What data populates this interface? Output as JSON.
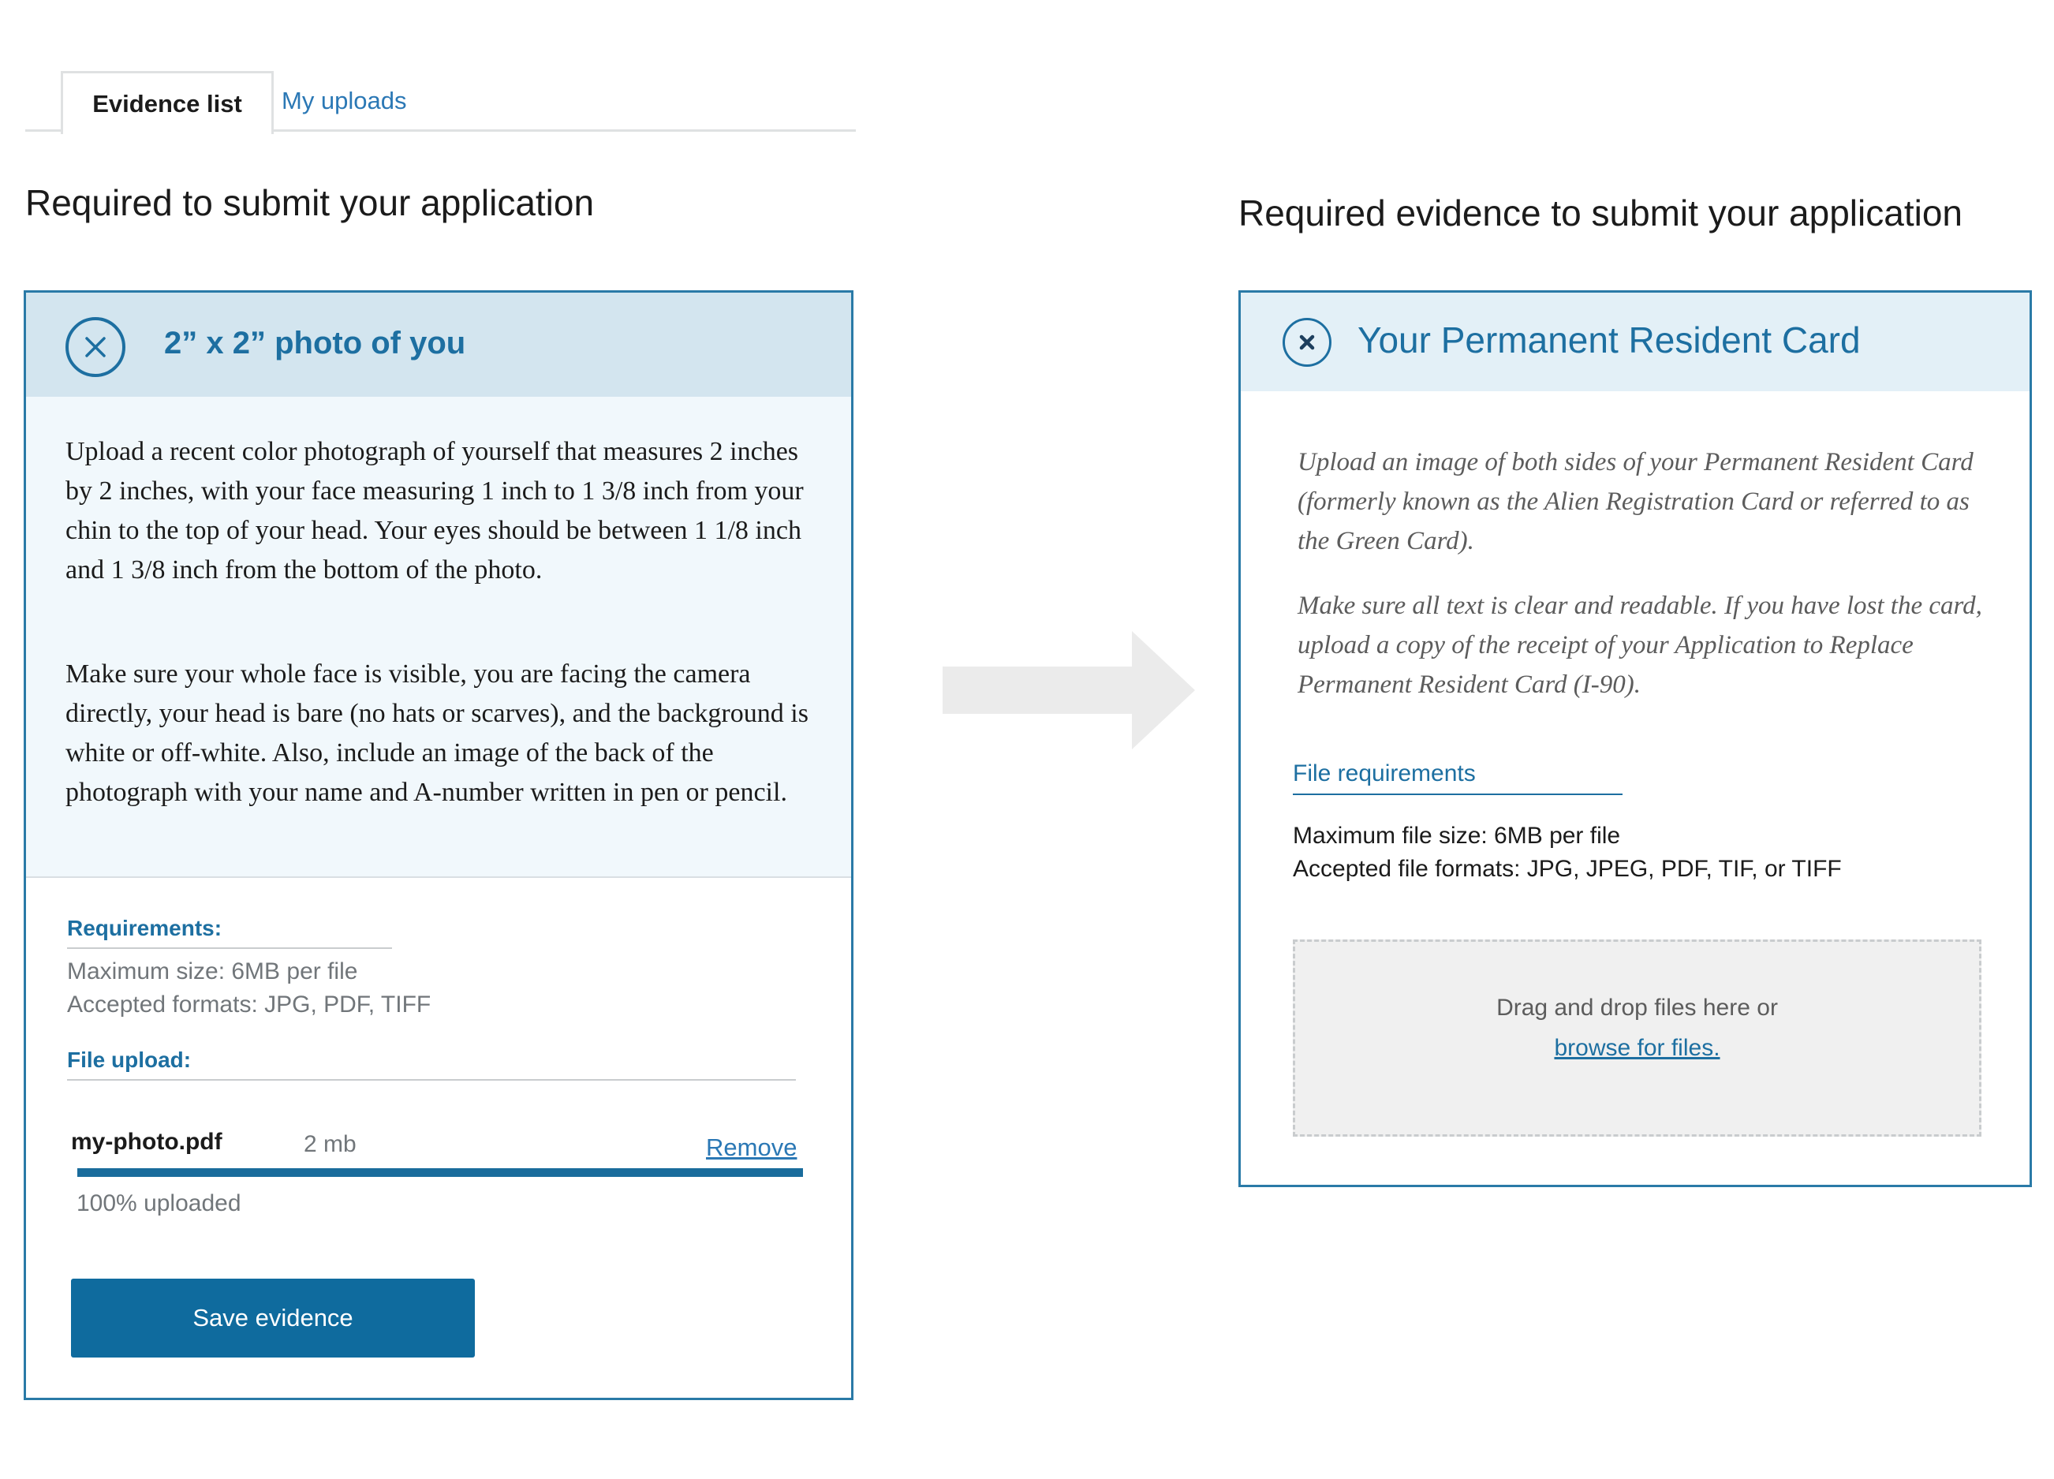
{
  "tabs": {
    "active": "Evidence list",
    "other": "My uploads"
  },
  "left": {
    "heading": "Required to submit your application",
    "card": {
      "title": "2” x 2” photo of you",
      "paragraph1": "Upload a recent color photograph of yourself that measures 2 inches by 2 inches, with your face measuring 1 inch to 1 3/8 inch from your chin to the top of your head. Your eyes should be between 1 1/8 inch and 1 3/8 inch from the bottom of the photo.",
      "paragraph2": "Make sure your whole face is visible, you are facing the camera directly, your head is bare (no hats or scarves), and the background is white or off-white. Also, include an image of the back of the photograph with your name and A-number written in pen or pencil.",
      "requirements_label": "Requirements:",
      "requirements_line1": "Maximum size: 6MB per file",
      "requirements_line2": "Accepted formats: JPG, PDF, TIFF",
      "file_upload_label": "File upload:",
      "file_name": "my-photo.pdf",
      "file_size": "2 mb",
      "remove_label": "Remove",
      "progress_percent": 100,
      "progress_text": "100% uploaded",
      "save_label": "Save evidence"
    }
  },
  "right": {
    "heading": "Required evidence to submit your application",
    "card": {
      "title": "Your Permanent Resident Card",
      "paragraph1": "Upload an image of both sides of your Permanent Resident Card (formerly known as the Alien Registration Card or referred to as the Green Card).",
      "paragraph2": "Make sure all text is clear and readable. If you have lost the card, upload a copy of the receipt of your Application to Replace Permanent Resident Card (I-90).",
      "file_requirements_label": "File requirements",
      "max_size": "Maximum file size: 6MB per file",
      "formats": "Accepted file formats: JPG, JPEG, PDF, TIF, or TIFF",
      "dropzone_text": "Drag and drop files here or",
      "dropzone_link": "browse for files."
    }
  },
  "icons": {
    "close": "close-circle-icon",
    "arrow": "arrow-right-icon"
  },
  "colors": {
    "primary": "#1d6fa1",
    "button": "#0f6b9e",
    "header_bg_left": "#d3e5ef",
    "header_bg_right": "#e3f0f7",
    "link": "#2b78b5"
  }
}
